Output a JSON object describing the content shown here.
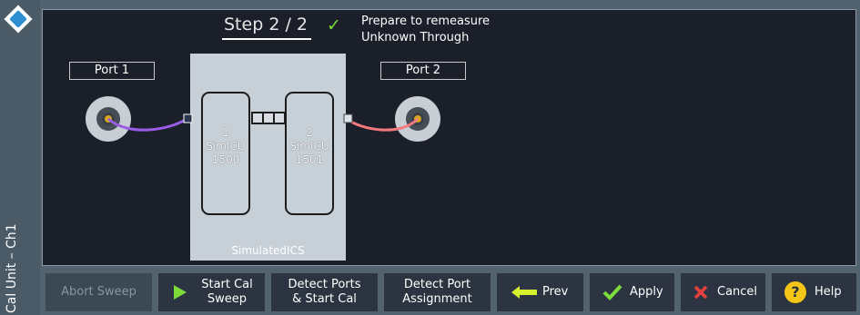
{
  "sidebar": {
    "title": "Cal Unit – Ch1"
  },
  "wizard": {
    "step_label": "Step",
    "step_current": "2 / 2",
    "message_line1": "Prepare to remeasure",
    "message_line2": "Unknown Through"
  },
  "ports": {
    "port1": "Port 1",
    "port2": "Port 2"
  },
  "cal_unit": {
    "name": "SimulatedICS",
    "modules": [
      {
        "number": "1",
        "line1": "SimICU",
        "line2": "1500"
      },
      {
        "number": "2",
        "line1": "SimICU",
        "line2": "1501"
      }
    ]
  },
  "toolbar": {
    "abort": "Abort Sweep",
    "start_line1": "Start Cal",
    "start_line2": "Sweep",
    "detect_line1": "Detect Ports",
    "detect_line2": "& Start Cal",
    "assign_line1": "Detect Port",
    "assign_line2": "Assignment",
    "prev": "Prev",
    "apply": "Apply",
    "cancel": "Cancel",
    "help": "Help"
  },
  "colors": {
    "check": "#7bdc3a",
    "cable1": "#9b5de5",
    "cable2": "#f47a7f",
    "cancel": "#e8413d",
    "help": "#f5c518"
  },
  "icons": {
    "logo": "rohde-schwarz-logo-icon",
    "step_done": "check-icon",
    "start": "play-icon",
    "prev": "arrow-left-icon",
    "apply": "check-icon",
    "cancel": "x-icon",
    "help": "question-icon"
  }
}
